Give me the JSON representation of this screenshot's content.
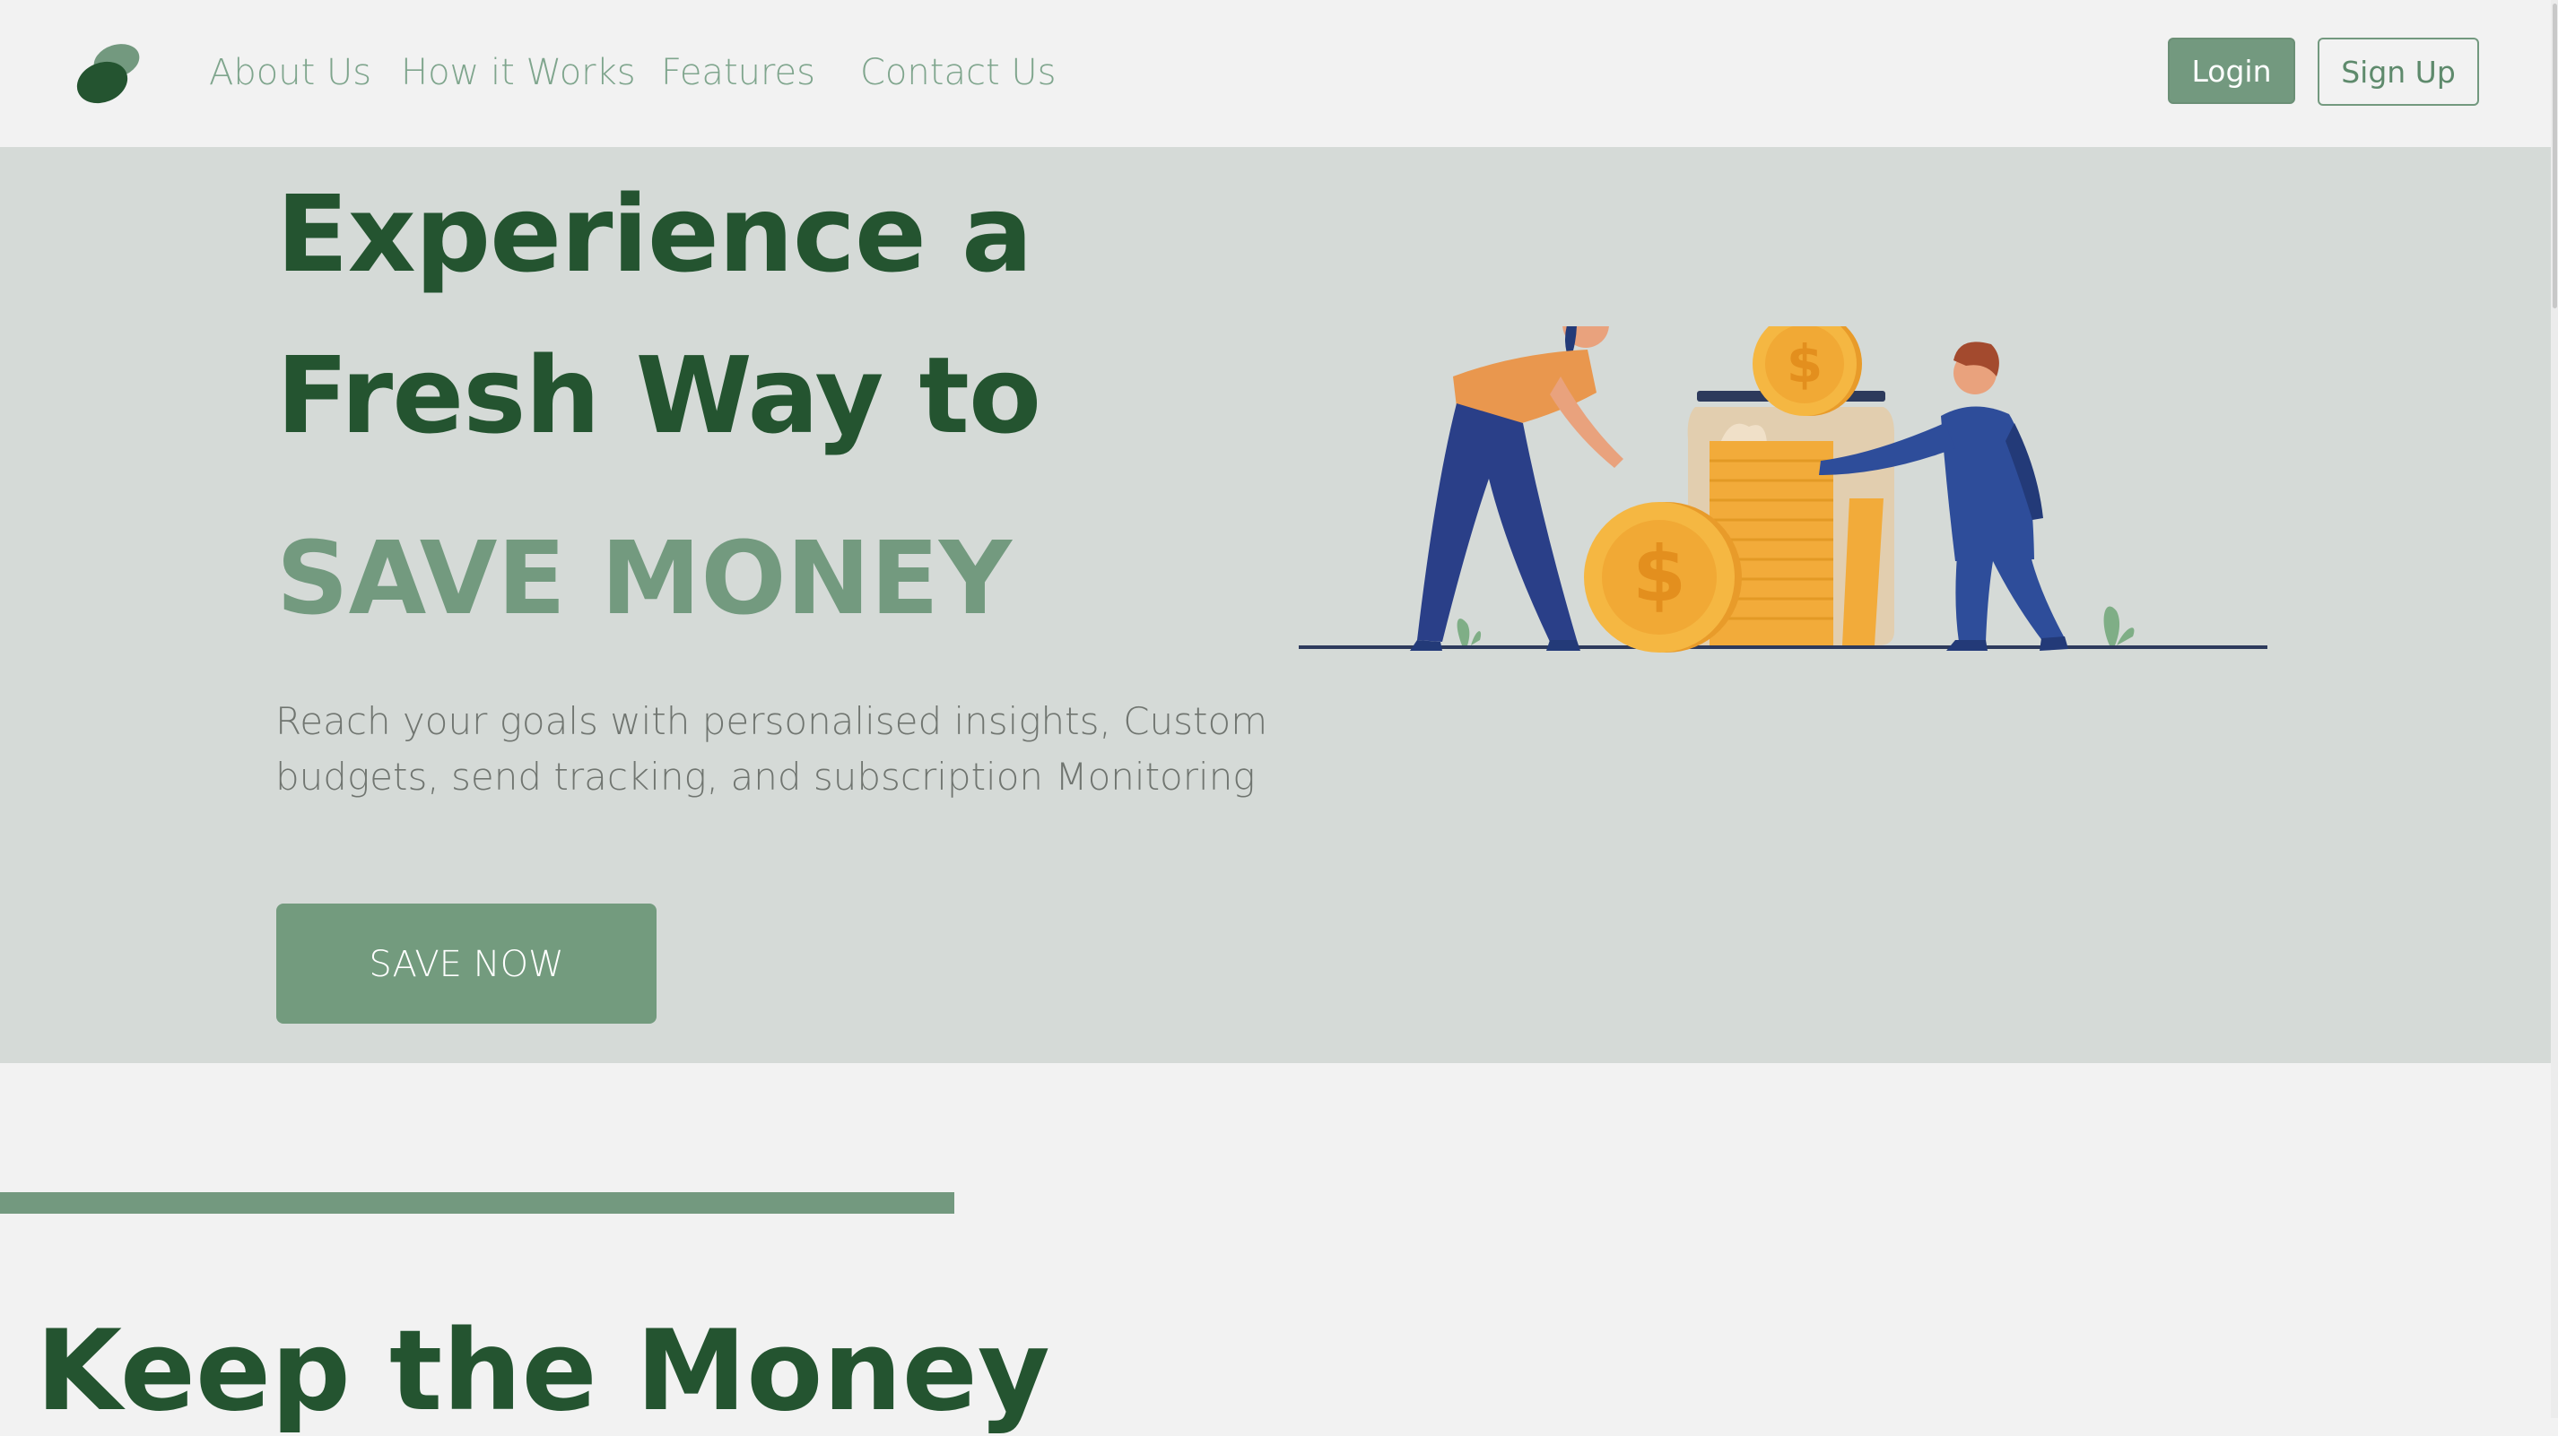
{
  "nav": {
    "links": [
      "About Us",
      "How it Works",
      "Features",
      "Contact Us"
    ],
    "login_label": "Login",
    "signup_label": "Sign Up"
  },
  "hero": {
    "title_line1": "Experience a",
    "title_line2": "Fresh Way to",
    "highlight": "SAVE MONEY",
    "subtitle_line1": "Reach your goals with personalised insights, Custom",
    "subtitle_line2": "budgets, send tracking, and subscription Monitoring",
    "cta_label": "SAVE NOW"
  },
  "section": {
    "title": "Keep the Money"
  },
  "colors": {
    "brand_dark": "#245430",
    "brand_accent": "#739a7f",
    "hero_bg": "#d5dad7",
    "page_bg": "#f2f2f2"
  },
  "icons": {
    "logo": "leaf-blob-logo",
    "illustration": "people-saving-coins-jar"
  }
}
